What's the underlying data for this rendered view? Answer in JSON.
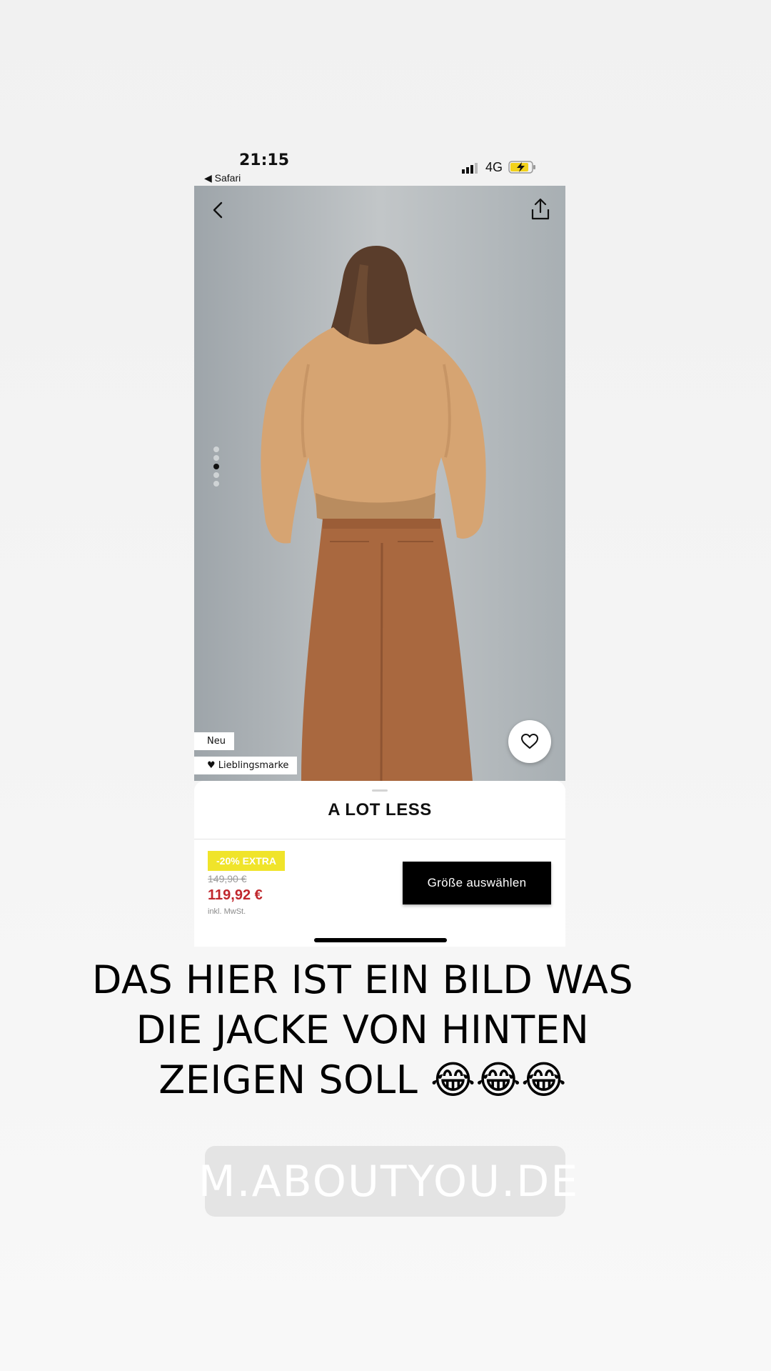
{
  "status_bar": {
    "time": "21:15",
    "back_app": "◀ Safari",
    "network": "4G"
  },
  "product": {
    "tag_new": "Neu",
    "tag_favorite": "Lieblingsmarke",
    "brand": "A LOT LESS",
    "discount_badge": "-20% EXTRA",
    "old_price": "149,90 €",
    "new_price": "119,92 €",
    "vat_note": "inkl. MwSt.",
    "size_button": "Größe auswählen",
    "image_dots": 5,
    "active_dot": 3
  },
  "story": {
    "caption_line1": "DAS HIER IST EIN BILD WAS",
    "caption_line2": "DIE JACKE VON HINTEN",
    "caption_line3": "ZEIGEN SOLL 😂😂😂",
    "link_text": "M.ABOUTYOU.DE"
  },
  "colors": {
    "badge": "#f0e42a",
    "price": "#c0272d",
    "button": "#000000"
  },
  "icons": [
    "back-arrow-icon",
    "share-icon",
    "heart-icon",
    "link-icon",
    "battery-charging-icon",
    "signal-icon"
  ]
}
